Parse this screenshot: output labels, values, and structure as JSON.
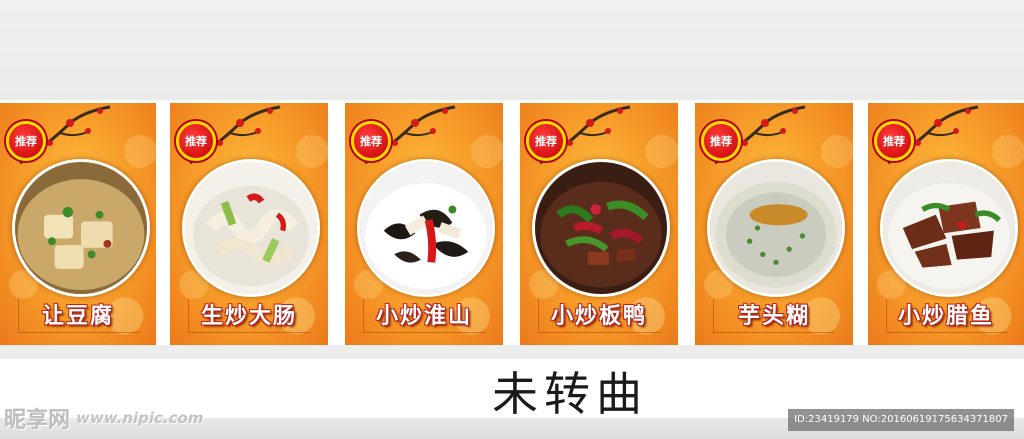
{
  "badge_label": "推荐",
  "dishes": [
    {
      "name": "让豆腐"
    },
    {
      "name": "生炒大肠"
    },
    {
      "name": "小炒淮山"
    },
    {
      "name": "小炒板鸭"
    },
    {
      "name": "芋头糊"
    },
    {
      "name": "小炒腊鱼"
    }
  ],
  "caption": "未转曲",
  "watermark": {
    "logo_text": "昵享网",
    "url": "www.nipic.com",
    "id_text": "ID:23419179 NO:20160619175634371807"
  },
  "colors": {
    "card_orange": "#f8a12c",
    "badge_red": "#c40000",
    "badge_ring": "#ffd800"
  }
}
